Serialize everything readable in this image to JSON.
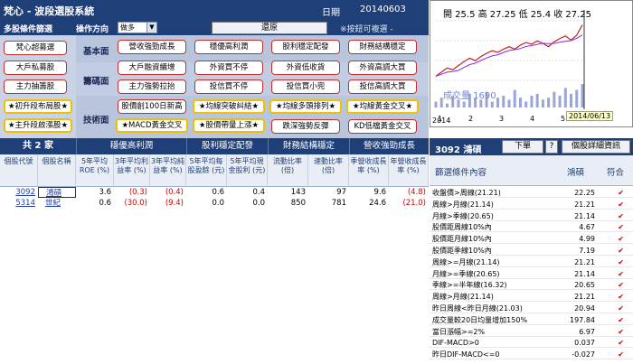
{
  "title": {
    "app": "梵心 - 波段選股系統",
    "date_label": "日期",
    "date_value": "20140603"
  },
  "condbar": {
    "multi_label": "多股條件篩選",
    "direction_label": "操作方向",
    "direction_value": "做多",
    "restore_label": "還原",
    "hint": "※按鈕可複選 -"
  },
  "left_buttons": [
    "梵心超募選",
    "大戶私募股",
    "主力抽籌股"
  ],
  "section_labels": {
    "basic": "基本面",
    "chips": "籌碼面",
    "tech": "技術面"
  },
  "basic_buttons": [
    "營收強勁成長",
    "穩優高利潤",
    "股利穩定配發",
    "財務結構穩定"
  ],
  "chips_buttons": [
    "大戶融資續增",
    "外資買不停",
    "外資低收貨",
    "外資高調大買",
    "主力強勢拉抬",
    "投信買不停",
    "投信買小兜",
    "投信高調大買"
  ],
  "tech_left_buttons": [
    "★初升段布局股★",
    "★主升段啟漲股★"
  ],
  "tech_buttons": [
    "股價創100日新高",
    "★均線突破糾結★",
    "★均線多頭排列★",
    "★均線黃金交叉★",
    "★MACD黃金交叉",
    "★股價帶量上漲★",
    "跌深強勢反彈",
    "KD低檔黃金交叉"
  ],
  "count": "共 2 家",
  "table": {
    "groups": [
      "穩優高利潤",
      "股利穩定配發",
      "財務結構穩定",
      "營收強勁成長"
    ],
    "columns": [
      "個股代號",
      "個股名稱",
      "5年平均ROE (%)",
      "3年平均利益率 (%)",
      "3年平均純益率 (%)",
      "5年平均每股盈餘 (元)",
      "5年平均現金股利 (元)",
      "流動比率 (倍)",
      "速動比率 (倍)",
      "季營收成長率 (%)",
      "年營收成長率 (%)"
    ],
    "rows": [
      {
        "code": "3092",
        "name": "鴻碩",
        "roe": "3.6",
        "profit": "(0.3)",
        "net": "(0.4)",
        "eps": "0.6",
        "div": "0.4",
        "curr": "143",
        "quick": "97",
        "qrev": "9.6",
        "yrev": "(4.8)"
      },
      {
        "code": "5314",
        "name": "世紀",
        "roe": "0.6",
        "profit": "(30.0)",
        "net": "(9.4)",
        "eps": "0.0",
        "div": "0.0",
        "curr": "850",
        "quick": "781",
        "qrev": "24.6",
        "yrev": "(21.0)"
      }
    ]
  },
  "chart_data": {
    "type": "line",
    "title": "開 25.5 高 27.25 低 25.4 收 27.25",
    "volume_label": "成交量 1690",
    "x_ticks": [
      "1",
      "2",
      "3",
      "4",
      "5",
      "2014/06/13"
    ],
    "year": "2014",
    "close_trend": [
      21,
      21.5,
      22,
      21.8,
      22.3,
      22.8,
      23.2,
      22.9,
      23.4,
      23.8,
      24.1,
      23.9,
      24.3,
      24.6,
      24.3,
      24.8,
      25.1,
      24.9,
      25.3,
      25.0,
      24.6,
      25.2,
      25.6,
      25.9,
      25.4,
      26.0,
      27.25
    ],
    "volume": [
      3,
      5,
      2,
      6,
      4,
      3,
      7,
      5,
      4,
      8,
      3,
      5,
      6,
      4,
      9,
      5,
      3,
      6,
      7,
      4,
      5,
      8,
      6,
      10,
      7,
      9,
      12
    ]
  },
  "right_panel": {
    "code": "3092  鴻碩",
    "buttons": [
      "下單",
      "?",
      "個股詳細資訊"
    ],
    "hdr_left": "篩選條件內容",
    "hdr_mid": "鴻碩",
    "hdr_right": "符合",
    "rows": [
      {
        "name": "收盤價>周線(21.21)",
        "value": "22.25"
      },
      {
        "name": "周線>月線(21.14)",
        "value": "21.21"
      },
      {
        "name": "月線>季線(20.65)",
        "value": "21.14"
      },
      {
        "name": "股價距周線10%內",
        "value": "4.67"
      },
      {
        "name": "股價距月線10%內",
        "value": "4.99"
      },
      {
        "name": "股價距季線10%內",
        "value": "7.19"
      },
      {
        "name": "周線>=月線(21.14)",
        "value": "21.21"
      },
      {
        "name": "月線>=季線(20.65)",
        "value": "21.14"
      },
      {
        "name": "季線>=半年線(16.32)",
        "value": "20.65"
      },
      {
        "name": "周線>月線(21.14)",
        "value": "21.21"
      },
      {
        "name": "昨日周線<昨日月線(21.03)",
        "value": "20.94"
      },
      {
        "name": "成交量較20日均量增加150%",
        "value": "197.84"
      },
      {
        "name": "當日漲幅>=2%",
        "value": "6.97"
      },
      {
        "name": "DIF-MACD>0",
        "value": "0.037"
      },
      {
        "name": "昨日DIF-MACD<=0",
        "value": "-0.027"
      }
    ],
    "check": "✔"
  }
}
